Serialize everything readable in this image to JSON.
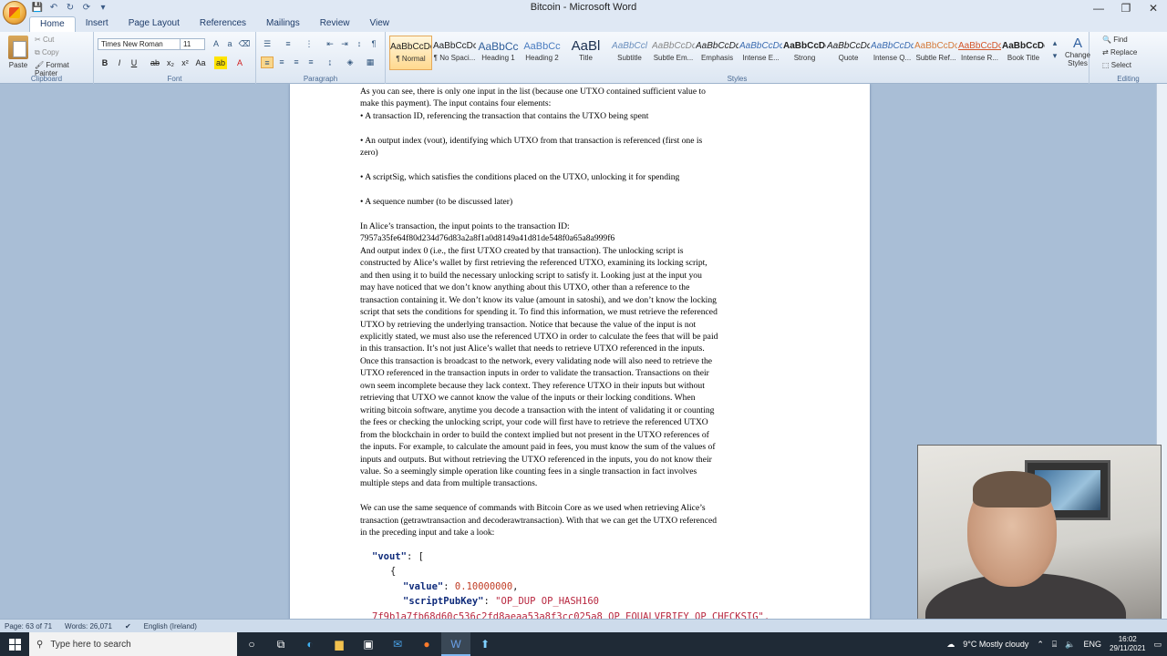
{
  "window": {
    "title": "Bitcoin - Microsoft Word",
    "minimize": "—",
    "restore": "❐",
    "close": "✕"
  },
  "qat": [
    "💾",
    "↶",
    "↻",
    "⟳",
    "▾"
  ],
  "tabs": [
    "Home",
    "Insert",
    "Page Layout",
    "References",
    "Mailings",
    "Review",
    "View"
  ],
  "ribbon": {
    "clipboard": {
      "label": "Clipboard",
      "paste": "Paste",
      "cut": "Cut",
      "copy": "Copy",
      "format_painter": "Format Painter"
    },
    "font": {
      "label": "Font",
      "name": "Times New Roman",
      "size": "11"
    },
    "paragraph": {
      "label": "Paragraph"
    },
    "styles": {
      "label": "Styles",
      "items": [
        {
          "preview": "AaBbCcDc",
          "name": "¶ Normal"
        },
        {
          "preview": "AaBbCcDc",
          "name": "¶ No Spaci..."
        },
        {
          "preview": "AaBbCc",
          "name": "Heading 1"
        },
        {
          "preview": "AaBbCc",
          "name": "Heading 2"
        },
        {
          "preview": "AaBl",
          "name": "Title"
        },
        {
          "preview": "AaBbCcl",
          "name": "Subtitle"
        },
        {
          "preview": "AaBbCcDc",
          "name": "Subtle Em..."
        },
        {
          "preview": "AaBbCcDc",
          "name": "Emphasis"
        },
        {
          "preview": "AaBbCcDc",
          "name": "Intense E..."
        },
        {
          "preview": "AaBbCcDc",
          "name": "Strong"
        },
        {
          "preview": "AaBbCcDc",
          "name": "Quote"
        },
        {
          "preview": "AaBbCcDc",
          "name": "Intense Q..."
        },
        {
          "preview": "AaBbCcDc",
          "name": "Subtle Ref..."
        },
        {
          "preview": "AaBbCcDc",
          "name": "Intense R..."
        },
        {
          "preview": "AaBbCcDc",
          "name": "Book Title"
        }
      ],
      "change_styles": "Change Styles"
    },
    "editing": {
      "label": "Editing",
      "find": "Find",
      "replace": "Replace",
      "select": "Select"
    }
  },
  "document": {
    "lines": [
      "As you can see, there is only one input in the list (because one UTXO contained sufficient value to",
      "make this payment). The input contains four elements:",
      "• A transaction ID, referencing the transaction that contains the UTXO being spent",
      "",
      "• An output index (vout), identifying which UTXO from that transaction is referenced (first one is",
      "zero)",
      "",
      "• A scriptSig, which satisfies the conditions placed on the UTXO, unlocking it for spending",
      "",
      "• A sequence number (to be discussed later)",
      "",
      "In Alice’s transaction, the input points to the transaction ID:",
      "7957a35fe64f80d234d76d83a2a8f1a0d8149a41d81de548f0a65a8a999f6",
      "And output index 0 (i.e., the first UTXO created by that transaction). The unlocking script is",
      "constructed by Alice’s wallet by first retrieving the referenced UTXO, examining its locking script,",
      "and then using it to build the necessary unlocking script to satisfy it. Looking just at the input you",
      "may have noticed that we don’t know anything about this UTXO, other than a reference to the",
      "transaction containing it. We don’t know its value (amount in satoshi), and we don’t know the locking",
      "script that sets the conditions for spending it. To find this information, we must retrieve the referenced",
      "UTXO by retrieving the underlying transaction. Notice that because the value of the input is not",
      "explicitly stated, we must also use the referenced UTXO in order to calculate the fees that will be paid",
      "in this transaction. It’s not just Alice’s wallet that needs to retrieve UTXO referenced in the inputs.",
      "Once this transaction is broadcast to the network, every validating node will also need to retrieve the",
      "UTXO referenced in the transaction inputs in order to validate the transaction. Transactions on their",
      "own seem incomplete because they lack context. They reference UTXO in their inputs but without",
      "retrieving that UTXO we cannot know the value of the inputs or their locking conditions. When",
      "writing bitcoin software, anytime you decode a transaction with the intent of validating it or counting",
      "the fees or checking the unlocking script, your code will first have to retrieve the referenced UTXO",
      "from the blockchain in order to build the context implied but not present in the UTXO references of",
      "the inputs. For example, to calculate the amount paid in fees, you must know the sum of the values of",
      "inputs and outputs. But without retrieving the UTXO referenced in the inputs, you do not know their",
      "value. So a seemingly simple operation like counting fees in a single transaction in fact involves",
      "multiple steps and data from multiple transactions.",
      "",
      "We can use the same sequence of commands with Bitcoin Core as we used when retrieving Alice’s",
      "transaction (getrawtransaction and decoderawtransaction). With that we can get the UTXO referenced",
      "in the preceding input and take a look:"
    ],
    "code": {
      "line1_key": "\"vout\"",
      "line1_rest": ": [",
      "line2": "{",
      "value_key": "\"value\"",
      "value_val": "0.10000000",
      "spk_key": "\"scriptPubKey\"",
      "spk_val": "\"OP_DUP OP_HASH160",
      "line5": "7f9b1a7fb68d60c536c2fd8aeaa53a8f3cc025a8 OP_EQUALVERIFY OP_CHECKSIG\","
    }
  },
  "statusbar": {
    "page": "Page: 63 of 71",
    "words": "Words: 26,071",
    "language": "English (Ireland)"
  },
  "taskbar": {
    "search_placeholder": "Type here to search",
    "weather": "9°C  Mostly cloudy",
    "lang": "ENG",
    "time": "16:02",
    "date": "29/11/2021"
  }
}
